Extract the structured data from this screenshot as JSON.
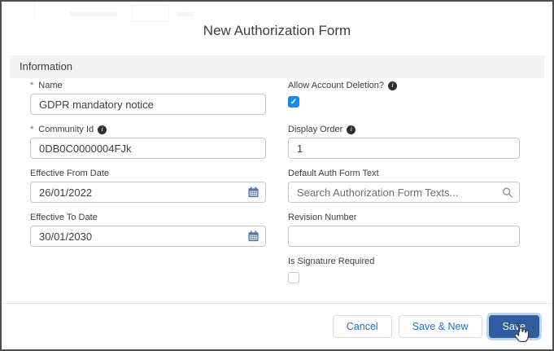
{
  "modal": {
    "title": "New Authorization Form"
  },
  "section": {
    "title": "Information"
  },
  "fields": {
    "name": {
      "label": "Name",
      "required": "*",
      "value": "GDPR mandatory notice"
    },
    "community_id": {
      "label": "Community Id",
      "required": "*",
      "value": "0DB0C0000004FJk",
      "info_icon": "info-icon"
    },
    "effective_from_date": {
      "label": "Effective From Date",
      "value": "26/01/2022",
      "trailing_icon": "calendar-icon"
    },
    "effective_to_date": {
      "label": "Effective To Date",
      "value": "30/01/2030",
      "trailing_icon": "calendar-icon"
    },
    "allow_account_deletion": {
      "label": "Allow Account Deletion?",
      "checked": true,
      "info_icon": "info-icon"
    },
    "display_order": {
      "label": "Display Order",
      "value": "1",
      "info_icon": "info-icon"
    },
    "default_auth_form_text": {
      "label": "Default Auth Form Text",
      "placeholder": "Search Authorization Form Texts...",
      "trailing_icon": "search-icon"
    },
    "revision_number": {
      "label": "Revision Number",
      "value": ""
    },
    "is_signature_required": {
      "label": "Is Signature Required",
      "checked": false
    }
  },
  "footer": {
    "cancel_label": "Cancel",
    "save_new_label": "Save & New",
    "save_label": "Save"
  },
  "colors": {
    "checkbox_checked": "#1589ee",
    "brand_button": "#2e5c9e",
    "link_button_text": "#2272c7",
    "calendar_icon": "#5876a3",
    "section_bg": "#f3f2f2",
    "input_border": "#c9c7c5",
    "info_icon_bg": "#32302c"
  },
  "info_icon_glyph": "i",
  "check_glyph": "✓"
}
